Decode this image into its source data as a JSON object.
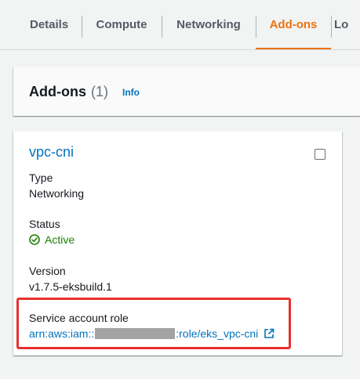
{
  "tabs": [
    {
      "label": "Details",
      "active": false
    },
    {
      "label": "Compute",
      "active": false
    },
    {
      "label": "Networking",
      "active": false
    },
    {
      "label": "Add-ons",
      "active": true
    },
    {
      "label": "Lo",
      "active": false
    }
  ],
  "addons_panel": {
    "title": "Add-ons",
    "count": "(1)",
    "info_label": "Info"
  },
  "addon_card": {
    "name": "vpc-cni",
    "type_label": "Type",
    "type_value": "Networking",
    "status_label": "Status",
    "status_value": "Active",
    "status_icon": "check-circle-icon",
    "version_label": "Version",
    "version_value": "v1.7.5-eksbuild.1",
    "role_label": "Service account role",
    "role_prefix": "arn:aws:iam::",
    "role_suffix": ":role/eks_vpc-cni",
    "role_icon": "external-link-icon"
  },
  "colors": {
    "accent": "#ec7211",
    "link": "#0073bb",
    "success": "#1d8102",
    "highlight": "#e8302f"
  }
}
